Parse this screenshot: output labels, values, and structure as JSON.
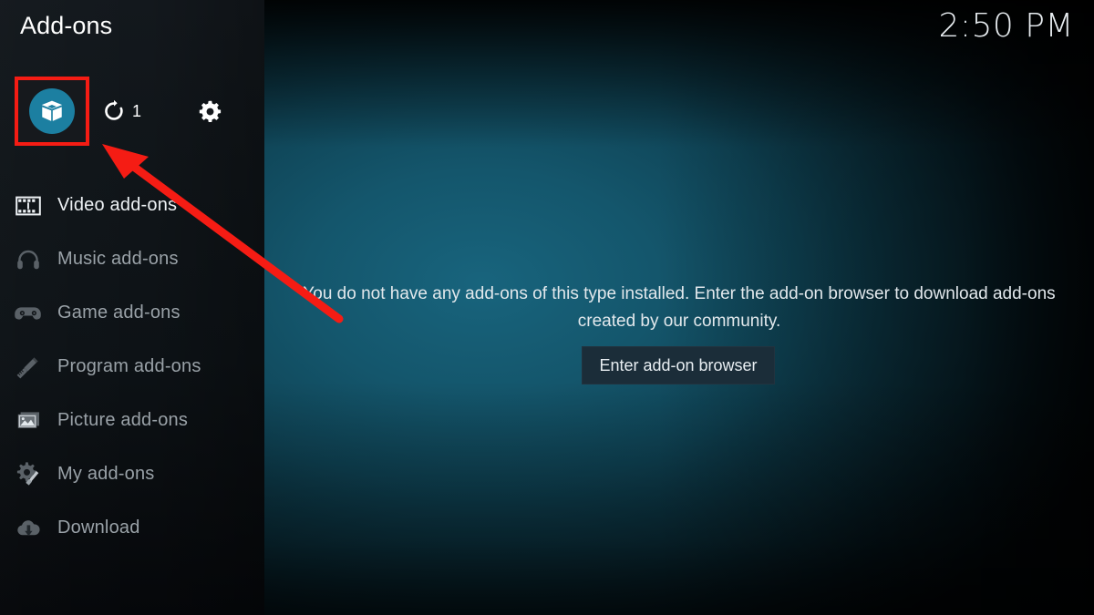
{
  "header": {
    "title": "Add-ons",
    "clock": "2:50 PM"
  },
  "toolbar": {
    "items": [
      {
        "name": "addon-browser",
        "icon": "package-box-icon",
        "label": "",
        "highlighted": true
      },
      {
        "name": "check-updates",
        "icon": "refresh-icon",
        "label": "1",
        "highlighted": false
      },
      {
        "name": "addon-settings",
        "icon": "gear-icon",
        "label": "",
        "highlighted": false
      }
    ],
    "update_count": "1"
  },
  "sidebar": {
    "items": [
      {
        "label": "Video add-ons",
        "icon": "film-strip-icon",
        "selected": true
      },
      {
        "label": "Music add-ons",
        "icon": "headphones-icon",
        "selected": false
      },
      {
        "label": "Game add-ons",
        "icon": "gamepad-icon",
        "selected": false
      },
      {
        "label": "Program add-ons",
        "icon": "pencil-ruler-icon",
        "selected": false
      },
      {
        "label": "Picture add-ons",
        "icon": "photo-icon",
        "selected": false
      },
      {
        "label": "My add-ons",
        "icon": "gear-tool-icon",
        "selected": false
      },
      {
        "label": "Download",
        "icon": "cloud-download-icon",
        "selected": false
      }
    ]
  },
  "main": {
    "empty_message": "You do not have any add-ons of this type installed. Enter the add-on browser to download add-ons created by our community.",
    "browser_button_label": "Enter add-on browser"
  },
  "annotation": {
    "type": "arrow",
    "color": "#f51c14",
    "highlight_box_color": "#f51c14"
  },
  "colors": {
    "accent_teal": "#1c7fa1",
    "annotation_red": "#f51c14",
    "button_bg": "#1b2d39",
    "sidebar_bg": "#101519",
    "text_primary": "#eef2f5",
    "text_muted": "#9aa2a8"
  }
}
